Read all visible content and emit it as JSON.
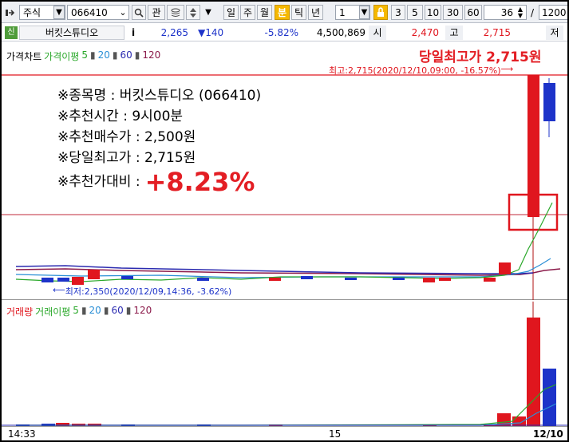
{
  "toolbar": {
    "market_select": "주식",
    "code_input": "066410",
    "btn_gwan": "관",
    "period_buttons": [
      "일",
      "주",
      "월",
      "분",
      "틱",
      "년"
    ],
    "active_period": "분",
    "interval_select": "1",
    "interval_buttons": [
      "1",
      "3",
      "5",
      "10",
      "30",
      "60"
    ],
    "active_interval": "1",
    "count_value": "36",
    "slash": "/",
    "total_value": "1200"
  },
  "info": {
    "market_badge": "신",
    "stock_name": "버킷스튜디오",
    "info_btn": "i",
    "price": "2,265",
    "change": "▼140",
    "change_pct": "-5.82%",
    "volume": "4,500,869",
    "open_label": "시",
    "open_value": "2,470",
    "high_label": "고",
    "high_value": "2,715",
    "low_label": "저"
  },
  "price_legend": {
    "main": "가격차트",
    "ma_label": "가격이평",
    "periods": [
      "5",
      "20",
      "60",
      "120"
    ]
  },
  "price_chart": {
    "headline": "당일최고가 2,715원",
    "high_note": "최고:2,715(2020/12/10,09:00, -16.57%)",
    "high_arrow": "⟶",
    "low_note": "최저:2,350(2020/12/09,14:36, -3.62%)",
    "low_arrow": "⟵"
  },
  "overlay": {
    "lines": [
      "※종목명 : 버킷스튜디오 (066410)",
      "※추천시간 : 9시00분",
      "※추천매수가 : 2,500원",
      "※당일최고가 : 2,715원"
    ],
    "ratio_label": "※추천가대비 : ",
    "ratio_value": "+8.23%"
  },
  "vol_legend": {
    "main": "거래량",
    "ma_label": "거래이평",
    "periods": [
      "5",
      "20",
      "60",
      "120"
    ]
  },
  "time_axis": {
    "labels": [
      "14:33",
      "15",
      "12/10"
    ]
  },
  "colors": {
    "up": "#e0161e",
    "down": "#1d33c9",
    "ma5": "#2aa82a",
    "ma20": "#2a8fd6",
    "ma60": "#2b2bb0",
    "ma120": "#8b1a4a",
    "active": "#f5b800"
  },
  "chart_data": {
    "type": "candlestick",
    "high_point": {
      "price": 2715,
      "time": "2020/12/10 09:00",
      "pct": -16.57
    },
    "low_point": {
      "price": 2350,
      "time": "2020/12/09 14:36",
      "pct": -3.62
    },
    "recommended_buy": 2500,
    "x_labels": [
      "14:33",
      "15",
      "12/10"
    ]
  }
}
